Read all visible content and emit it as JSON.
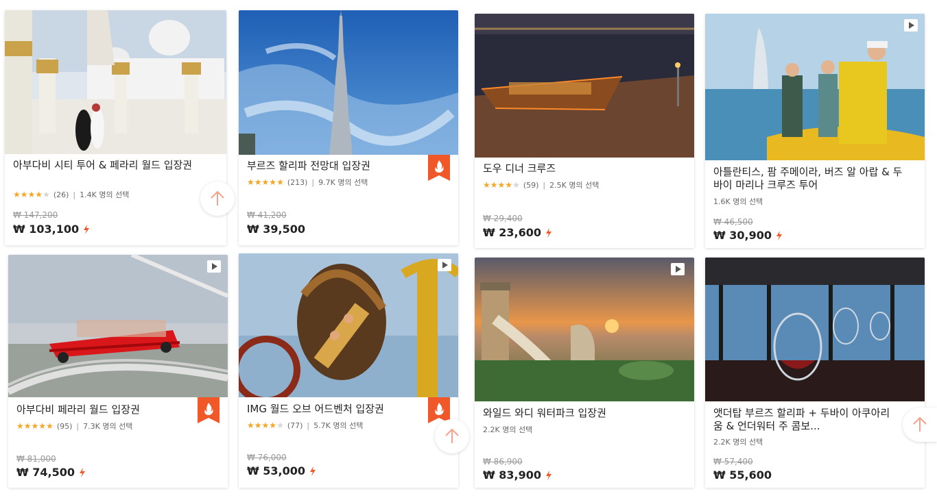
{
  "colors": {
    "star": "#f5a623",
    "accent": "#f0582a",
    "hot_badge": "#f0582a"
  },
  "cards": [
    {
      "title": "아부다비 시티 투어 & 페라리 월드 입장권",
      "stars": 4,
      "reviews": "(26)",
      "chosen": "1.4K 명의 선택",
      "old_price": "₩ 147,200",
      "price": "₩ 103,100"
    },
    {
      "title": "부르즈 할리파 전망대 입장권",
      "stars": 4.5,
      "reviews": "(213)",
      "chosen": "9.7K 명의 선택",
      "old_price": "₩ 41,200",
      "price": "₩ 39,500",
      "hot": true
    },
    {
      "title": "도우 디너 크루즈",
      "stars": 3.5,
      "reviews": "(59)",
      "chosen": "2.5K 명의 선택",
      "old_price": "₩ 29,400",
      "price": "₩ 23,600"
    },
    {
      "title": "아틀란티스, 팜 주메이라, 버즈 알 아랍 & 두바이 마리나 크루즈 투어",
      "chosen": "1.6K 명의 선택",
      "old_price": "₩ 46,500",
      "price": "₩ 30,900",
      "video": true
    },
    {
      "title": "아부다비 페라리 월드 입장권",
      "stars": 4.5,
      "reviews": "(95)",
      "chosen": "7.3K 명의 선택",
      "old_price": "₩ 81,000",
      "price": "₩ 74,500",
      "hot": true,
      "video": true
    },
    {
      "title": "IMG 월드 오브 어드벤처 입장권",
      "stars": 4,
      "reviews": "(77)",
      "chosen": "5.7K 명의 선택",
      "old_price": "₩ 76,000",
      "price": "₩ 53,000",
      "hot": true,
      "video": true
    },
    {
      "title": "와일드 와디 워터파크 입장권",
      "chosen": "2.2K 명의 선택",
      "old_price": "₩ 86,900",
      "price": "₩ 83,900",
      "video": true
    },
    {
      "title": "앳더탑 부르즈 할리파 + 두바이 아쿠아리움 & 언더워터 주 콤보...",
      "chosen": "2.2K 명의 선택",
      "old_price": "₩ 57,400",
      "price": "₩ 55,600"
    }
  ],
  "icons": {
    "scroll_top": "arrow-up-icon",
    "hot": "flame-icon",
    "video": "play-icon",
    "bolt": "lightning-icon"
  }
}
